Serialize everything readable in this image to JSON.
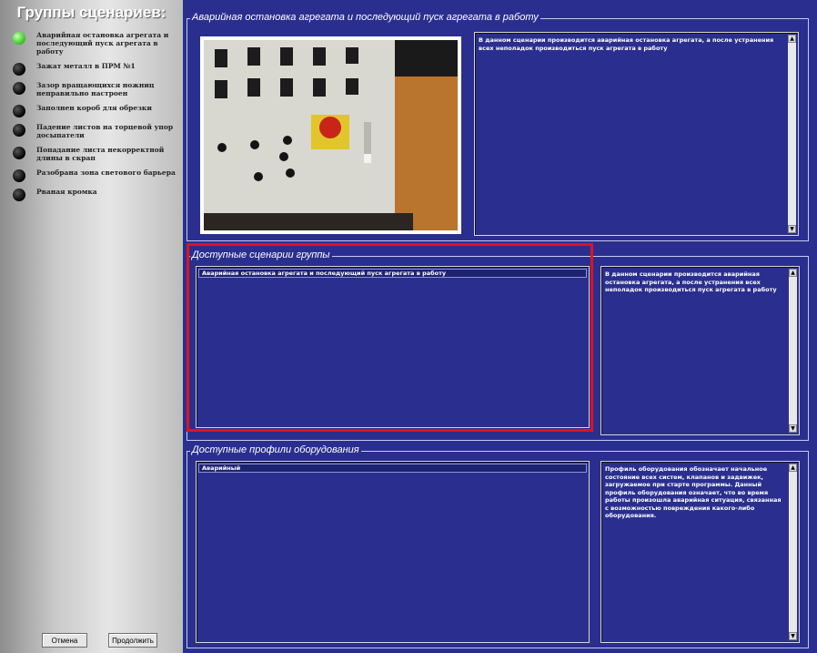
{
  "sidebar": {
    "title": "Группы сценариев:",
    "items": [
      {
        "label": "Аварийная остановка агрегата и последующий пуск агрегата в работу",
        "active": true
      },
      {
        "label": "Зажат металл в ПРМ №1",
        "active": false
      },
      {
        "label": "Зазор вращающихся ножниц неправильно настроен",
        "active": false
      },
      {
        "label": "Заполнен короб для обрезки",
        "active": false
      },
      {
        "label": "Падение листов на торцевой упор досыпатели",
        "active": false
      },
      {
        "label": "Попадание листа некорректной длины в скрап",
        "active": false
      },
      {
        "label": "Разобрана зона светового барьера",
        "active": false
      },
      {
        "label": "Рваная кромка",
        "active": false
      }
    ],
    "cancel_label": "Отмена",
    "continue_label": "Продолжить"
  },
  "scenario_panel": {
    "title": "Аварийная остановка агрегата и последующий пуск агрегата в работу",
    "description": "В данном сценарии производится аварийная остановка агрегата, а после устранения всех неполадок производиться пуск агрегата в работу"
  },
  "group_panel": {
    "title": "Доступные сценарии группы",
    "items": [
      "Аварийная остановка агрегата и последующий пуск агрегата в работу"
    ],
    "description": "В данном сценарии производится аварийная остановка агрегата, а после устранения всех неполадок производиться пуск агрегата в работу"
  },
  "profiles_panel": {
    "title": "Доступные профили оборудования",
    "items": [
      "Аварийный"
    ],
    "description": "Профиль оборудования обозначает начальное состояние всех систем, клапанов и задвижек, загружаемое при старте программы. Данный профиль оборудования означает, что во время работы произошла аварийная ситуация, связанная с возможностью повреждения какого-либо оборудования."
  },
  "colors": {
    "background": "#2a2f8f",
    "highlight": "#e0121f",
    "active_indicator": "#3fd12b"
  },
  "icons": {
    "scroll_up": "▲",
    "scroll_down": "▼"
  }
}
